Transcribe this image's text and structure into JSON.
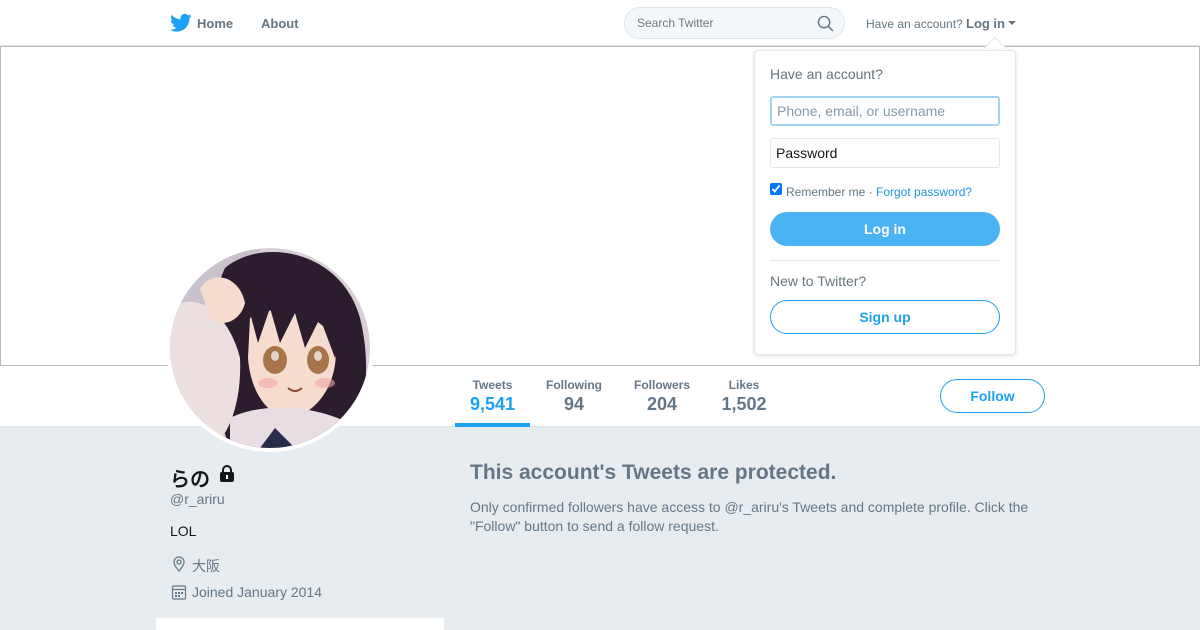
{
  "nav": {
    "home_label": "Home",
    "about_label": "About",
    "search_placeholder": "Search Twitter",
    "have_account": "Have an account?",
    "login_label": "Log in"
  },
  "profile_nav": {
    "stats": [
      {
        "label": "Tweets",
        "value": "9,541"
      },
      {
        "label": "Following",
        "value": "94"
      },
      {
        "label": "Followers",
        "value": "204"
      },
      {
        "label": "Likes",
        "value": "1,502"
      }
    ],
    "follow_label": "Follow"
  },
  "profile": {
    "name": "らの",
    "handle": "@r_ariru",
    "bio": "LOL",
    "location": "大阪",
    "joined": "Joined January 2014"
  },
  "protected": {
    "title": "This account's Tweets are protected.",
    "body": "Only confirmed followers have access to @r_ariru's Tweets and complete profile. Click the \"Follow\" button to send a follow request."
  },
  "login_dropdown": {
    "title": "Have an account?",
    "username_placeholder": "Phone, email, or username",
    "password_placeholder": "Password",
    "remember_label": "Remember me ·",
    "remember_checked": true,
    "forgot_label": "Forgot password?",
    "login_button": "Log in",
    "new_label": "New to Twitter?",
    "signup_button": "Sign up"
  },
  "colors": {
    "accent": "#1da1f2",
    "background": "#e6ecf0",
    "muted_text": "#657786"
  },
  "icons": [
    "twitter-bird-icon",
    "search-icon",
    "caret-down-icon",
    "lock-icon",
    "location-pin-icon",
    "calendar-icon"
  ]
}
